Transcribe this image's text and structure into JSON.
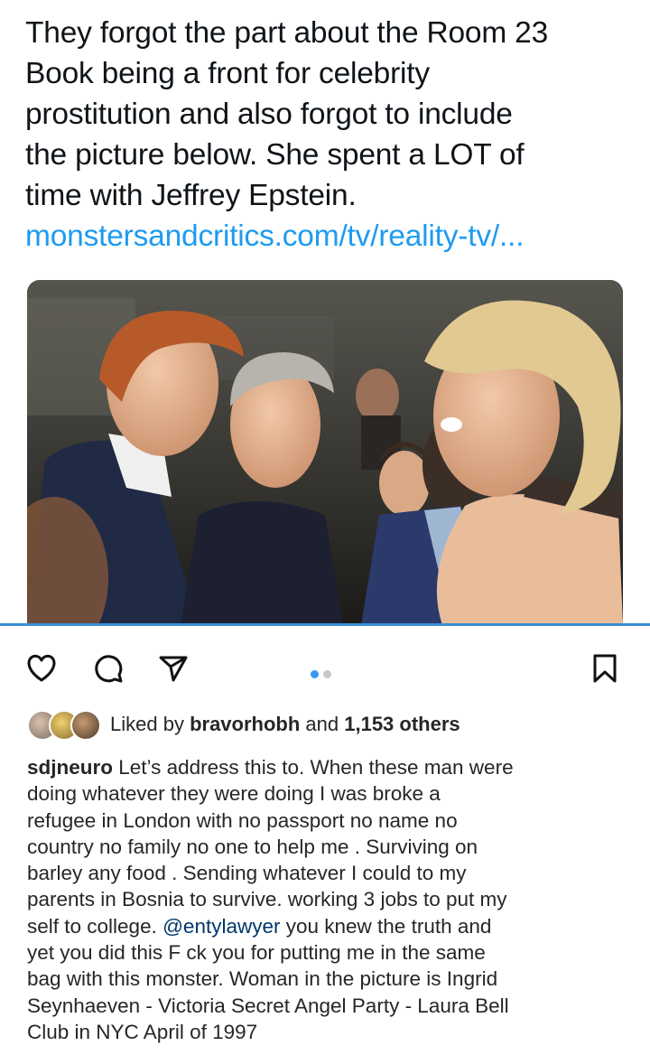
{
  "tweet": {
    "lines": [
      "They forgot the part about the Room 23",
      "Book being a front for celebrity",
      "prostitution and also forgot to include",
      "the picture below. She spent a LOT of",
      "time with Jeffrey Epstein."
    ],
    "link": "monstersandcritics.com/tv/reality-tv/..."
  },
  "post": {
    "carousel": {
      "count": 2,
      "active": 0
    },
    "icons": [
      "heart-icon",
      "comment-icon",
      "share-icon",
      "bookmark-icon"
    ]
  },
  "likes": {
    "prefix": "Liked by ",
    "user": "bravorhobh",
    "middle": " and ",
    "count": "1,153 others"
  },
  "caption": {
    "username": "sdjneuro",
    "first_line": " Let’s address this to.  When these man were",
    "lines_a": [
      "doing whatever they were doing I was broke a",
      "refugee in London with no passport no name no",
      "country no family no one to help me . Surviving on",
      "barley any food . Sending whatever I could to my",
      "parents in Bosnia to survive. working 3 jobs to put my"
    ],
    "pre_mention": "self to college.  ",
    "mention": "@entylawyer",
    "post_mention": " you knew the truth and",
    "lines_b": [
      "yet you did this F   ck you for putting me in the same",
      "bag with this monster. Woman in the picture is Ingrid",
      "Seynhaeven - Victoria Secret Angel Party - Laura Bell",
      "Club in NYC April of 1997"
    ]
  },
  "colors": {
    "link": "#1d9bf0",
    "mention": "#00376b",
    "carousel_active": "#3897f0",
    "divider": "#3b8ed0"
  }
}
